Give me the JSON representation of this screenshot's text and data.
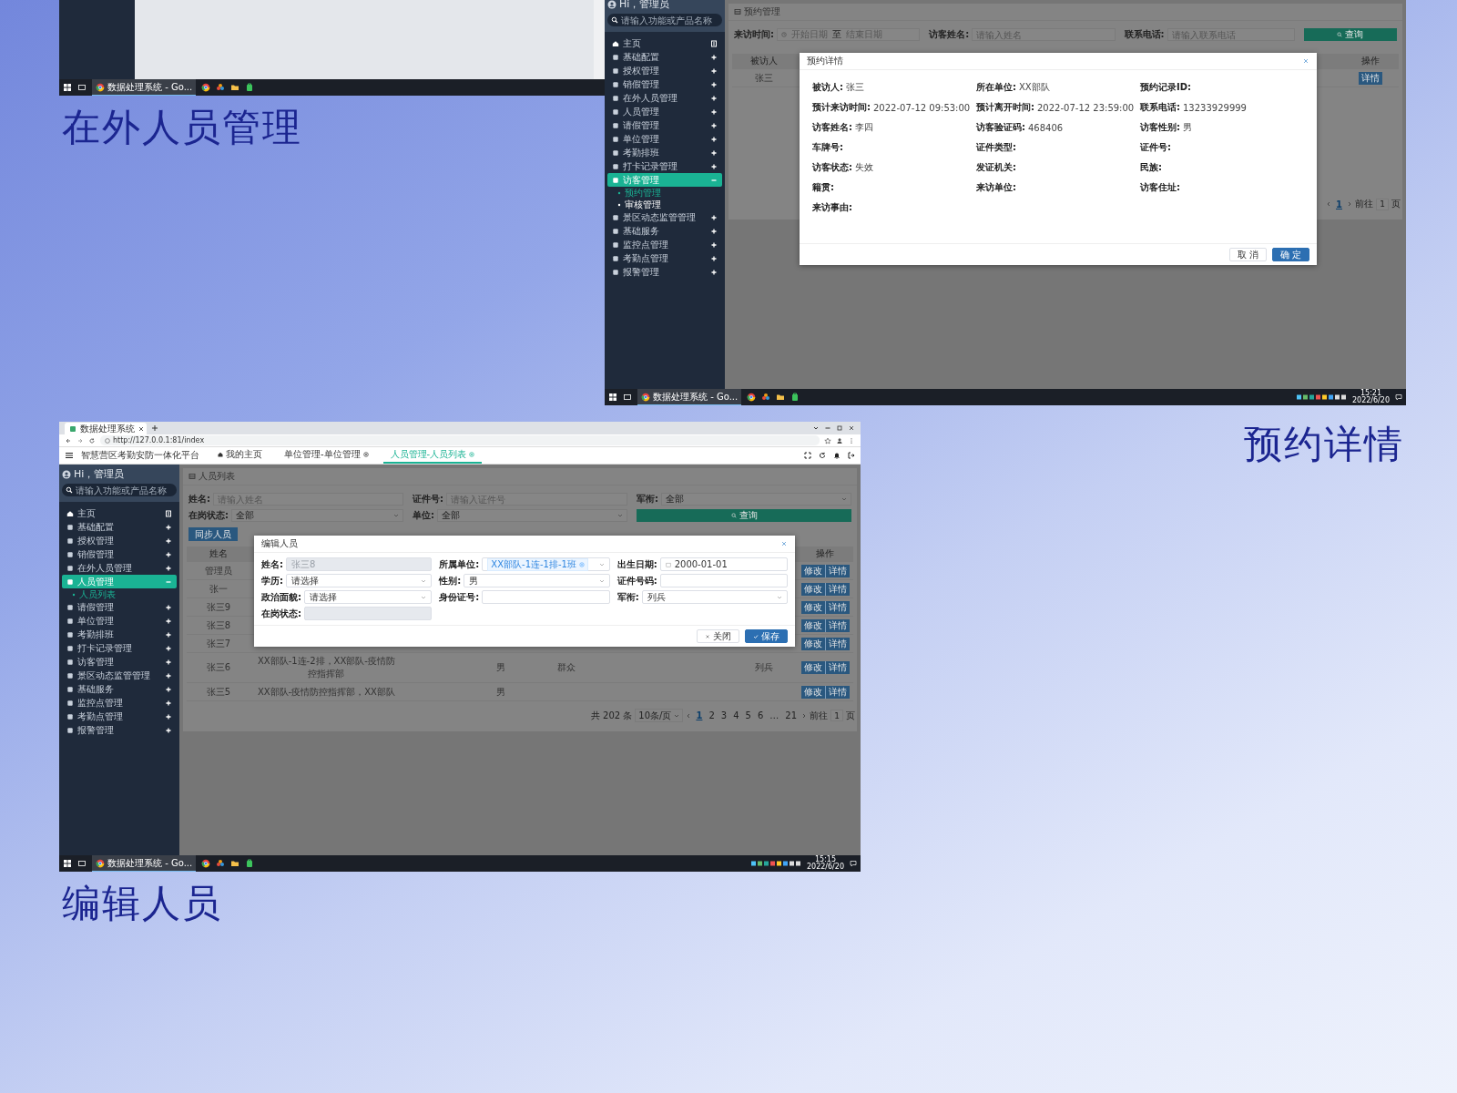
{
  "screens": [
    {
      "kind": "desktop",
      "caption": "在外人员管理",
      "taskbar": {
        "app_label": "数据处理系统 - Go..."
      }
    },
    {
      "kind": "app",
      "caption": "预约详情",
      "sidebar": {
        "greeting": "Hi，管理员",
        "search_placeholder": "请输入功能或产品名称",
        "items": [
          {
            "label": "主页",
            "kind": "home",
            "selected": false
          },
          {
            "label": "基础配置",
            "kind": "group",
            "selected": false,
            "expanded": false
          },
          {
            "label": "授权管理",
            "kind": "group",
            "selected": false,
            "expanded": false
          },
          {
            "label": "销假管理",
            "kind": "group",
            "selected": false,
            "expanded": false
          },
          {
            "label": "在外人员管理",
            "kind": "group",
            "selected": false,
            "expanded": false
          },
          {
            "label": "人员管理",
            "kind": "group",
            "selected": false,
            "expanded": false
          },
          {
            "label": "请假管理",
            "kind": "group",
            "selected": false,
            "expanded": false
          },
          {
            "label": "单位管理",
            "kind": "group",
            "selected": false,
            "expanded": false
          },
          {
            "label": "考勤排班",
            "kind": "group",
            "selected": false,
            "expanded": false
          },
          {
            "label": "打卡记录管理",
            "kind": "group",
            "selected": false,
            "expanded": false
          },
          {
            "label": "访客管理",
            "kind": "group",
            "selected": true,
            "expanded": true,
            "children": [
              {
                "label": "预约管理",
                "selected": true
              },
              {
                "label": "审核管理",
                "selected": false
              }
            ]
          },
          {
            "label": "景区动态监管管理",
            "kind": "group",
            "selected": false,
            "expanded": false
          },
          {
            "label": "基础服务",
            "kind": "group",
            "selected": false,
            "expanded": false
          },
          {
            "label": "监控点管理",
            "kind": "group",
            "selected": false,
            "expanded": false
          },
          {
            "label": "考勤点管理",
            "kind": "group",
            "selected": false,
            "expanded": false
          },
          {
            "label": "报警管理",
            "kind": "group",
            "selected": false,
            "expanded": false
          }
        ]
      },
      "page": {
        "title": "预约管理",
        "filters": [
          {
            "label": "来访时间:",
            "kind": "daterange",
            "start": "开始日期",
            "separator": "至",
            "end": "结束日期"
          },
          {
            "label": "访客姓名:",
            "kind": "input",
            "placeholder": "请输入姓名"
          },
          {
            "label": "联系电话:",
            "kind": "input",
            "placeholder": "请输入联系电话"
          }
        ],
        "search_button": "查询",
        "table": {
          "columns": [
            "被访人",
            "操作"
          ],
          "rows": [
            {
              "name": "张三",
              "actions": [
                "详情"
              ]
            }
          ]
        },
        "pagination": {
          "pages": [
            {
              "label": "1",
              "selected": true
            }
          ],
          "goto": "前往",
          "goto_value": "1",
          "unit": "页"
        }
      },
      "dialog": {
        "kind": "details",
        "title": "预约详情",
        "fields": [
          {
            "label": "被访人:",
            "value": "张三"
          },
          {
            "label": "所在单位:",
            "value": "XX部队"
          },
          {
            "label": "预约记录ID:"
          },
          {
            "label": "预计来访时间:",
            "value": "2022-07-12 09:53:00"
          },
          {
            "label": "预计离开时间:",
            "value": "2022-07-12 23:59:00"
          },
          {
            "label": "联系电话:",
            "value": "13233929999"
          },
          {
            "label": "访客姓名:",
            "value": "李四"
          },
          {
            "label": "访客验证码:",
            "value": "468406"
          },
          {
            "label": "访客性别:",
            "value": "男"
          },
          {
            "label": "车牌号:"
          },
          {
            "label": "证件类型:"
          },
          {
            "label": "证件号:"
          },
          {
            "label": "访客状态:",
            "value": "失效"
          },
          {
            "label": "发证机关:"
          },
          {
            "label": "民族:"
          },
          {
            "label": "籍贯:"
          },
          {
            "label": "来访单位:"
          },
          {
            "label": "访客住址:"
          },
          {
            "label": "来访事由:"
          }
        ],
        "buttons": [
          {
            "label": "取 消",
            "kind": "default"
          },
          {
            "label": "确 定",
            "kind": "primary"
          }
        ]
      },
      "taskbar": {
        "app_label": "数据处理系统 - Go...",
        "time": "15:21",
        "date": "2022/6/20"
      }
    },
    {
      "kind": "app",
      "caption": "编辑人员",
      "browser": {
        "tab_title": "数据处理系统",
        "url": "http://127.0.0.1:81/index"
      },
      "header": {
        "brand": "智慧营区考勤安防一体化平台",
        "tabs": [
          {
            "label": "我的主页",
            "kind": "home",
            "selected": false
          },
          {
            "label": "单位管理-单位管理",
            "kind": "page",
            "selected": false
          },
          {
            "label": "人员管理-人员列表",
            "kind": "page",
            "selected": true
          }
        ]
      },
      "sidebar": {
        "greeting": "Hi，管理员",
        "search_placeholder": "请输入功能或产品名称",
        "items": [
          {
            "label": "主页",
            "kind": "home",
            "selected": false
          },
          {
            "label": "基础配置",
            "kind": "group",
            "selected": false,
            "expanded": false
          },
          {
            "label": "授权管理",
            "kind": "group",
            "selected": false,
            "expanded": false
          },
          {
            "label": "销假管理",
            "kind": "group",
            "selected": false,
            "expanded": false
          },
          {
            "label": "在外人员管理",
            "kind": "group",
            "selected": false,
            "expanded": false
          },
          {
            "label": "人员管理",
            "kind": "group",
            "selected": true,
            "expanded": true,
            "children": [
              {
                "label": "人员列表",
                "selected": true
              }
            ]
          },
          {
            "label": "请假管理",
            "kind": "group",
            "selected": false,
            "expanded": false
          },
          {
            "label": "单位管理",
            "kind": "group",
            "selected": false,
            "expanded": false
          },
          {
            "label": "考勤排班",
            "kind": "group",
            "selected": false,
            "expanded": false
          },
          {
            "label": "打卡记录管理",
            "kind": "group",
            "selected": false,
            "expanded": false
          },
          {
            "label": "访客管理",
            "kind": "group",
            "selected": false,
            "expanded": false
          },
          {
            "label": "景区动态监管管理",
            "kind": "group",
            "selected": false,
            "expanded": false
          },
          {
            "label": "基础服务",
            "kind": "group",
            "selected": false,
            "expanded": false
          },
          {
            "label": "监控点管理",
            "kind": "group",
            "selected": false,
            "expanded": false
          },
          {
            "label": "考勤点管理",
            "kind": "group",
            "selected": false,
            "expanded": false
          },
          {
            "label": "报警管理",
            "kind": "group",
            "selected": false,
            "expanded": false
          }
        ]
      },
      "page": {
        "title": "人员列表",
        "filters": [
          {
            "label": "姓名:",
            "kind": "input",
            "placeholder": "请输入姓名"
          },
          {
            "label": "证件号:",
            "kind": "input",
            "placeholder": "请输入证件号"
          },
          {
            "label": "军衔:",
            "kind": "select",
            "value": "全部"
          },
          {
            "label": "在岗状态:",
            "kind": "select",
            "value": "全部"
          },
          {
            "label": "单位:",
            "kind": "select",
            "value": "全部"
          }
        ],
        "search_button": "查询",
        "sync_button": "同步人员",
        "table": {
          "columns": [
            "姓名",
            "操作"
          ],
          "rows": [
            {
              "name": "管理员",
              "actions": [
                "修改",
                "详情"
              ]
            },
            {
              "name": "张一",
              "actions": [
                "修改",
                "详情"
              ]
            },
            {
              "name": "张三9",
              "actions": [
                "修改",
                "详情"
              ]
            },
            {
              "name": "张三8",
              "actions": [
                "修改",
                "详情"
              ]
            },
            {
              "name": "张三7",
              "actions": [
                "修改",
                "详情"
              ]
            },
            {
              "name": "张三6",
              "unit": "XX部队-1连-2排，XX部队-疫情防控指挥部",
              "gender": "男",
              "politics": "群众",
              "rank": "列兵",
              "actions": [
                "修改",
                "详情"
              ]
            },
            {
              "name": "张三5",
              "unit": "XX部队-疫情防控指挥部，XX部队",
              "gender": "男",
              "actions": [
                "修改",
                "详情"
              ]
            }
          ]
        },
        "pagination": {
          "total": "共 202 条",
          "page_size": "10条/页",
          "pages": [
            {
              "label": "1",
              "selected": true
            },
            {
              "label": "2",
              "selected": false
            },
            {
              "label": "3",
              "selected": false
            },
            {
              "label": "4",
              "selected": false
            },
            {
              "label": "5",
              "selected": false
            },
            {
              "label": "6",
              "selected": false
            },
            {
              "label": "…",
              "selected": false
            },
            {
              "label": "21",
              "selected": false
            }
          ],
          "goto": "前往",
          "goto_value": "1",
          "unit": "页"
        }
      },
      "dialog": {
        "kind": "form",
        "title": "编辑人员",
        "fields": [
          {
            "label": "姓名:",
            "kind": "input",
            "value": "张三8",
            "disabled": true
          },
          {
            "label": "所属单位:",
            "kind": "tags",
            "tag": "XX部队-1连-1排-1班"
          },
          {
            "label": "出生日期:",
            "kind": "date",
            "value": "2000-01-01"
          },
          {
            "label": "学历:",
            "kind": "select",
            "value": "请选择"
          },
          {
            "label": "性别:",
            "kind": "select",
            "value": "男"
          },
          {
            "label": "证件号码:",
            "kind": "input",
            "disabled": false
          },
          {
            "label": "政治面貌:",
            "kind": "select",
            "value": "请选择"
          },
          {
            "label": "身份证号:",
            "kind": "input",
            "disabled": false
          },
          {
            "label": "军衔:",
            "kind": "select",
            "value": "列兵"
          },
          {
            "label": "在岗状态:",
            "kind": "input",
            "disabled": true
          }
        ],
        "buttons": [
          {
            "label": "关闭",
            "kind": "default"
          },
          {
            "label": "保存",
            "kind": "primary"
          }
        ]
      },
      "taskbar": {
        "app_label": "数据处理系统 - Go...",
        "time": "15:15",
        "date": "2022/6/20"
      }
    }
  ]
}
